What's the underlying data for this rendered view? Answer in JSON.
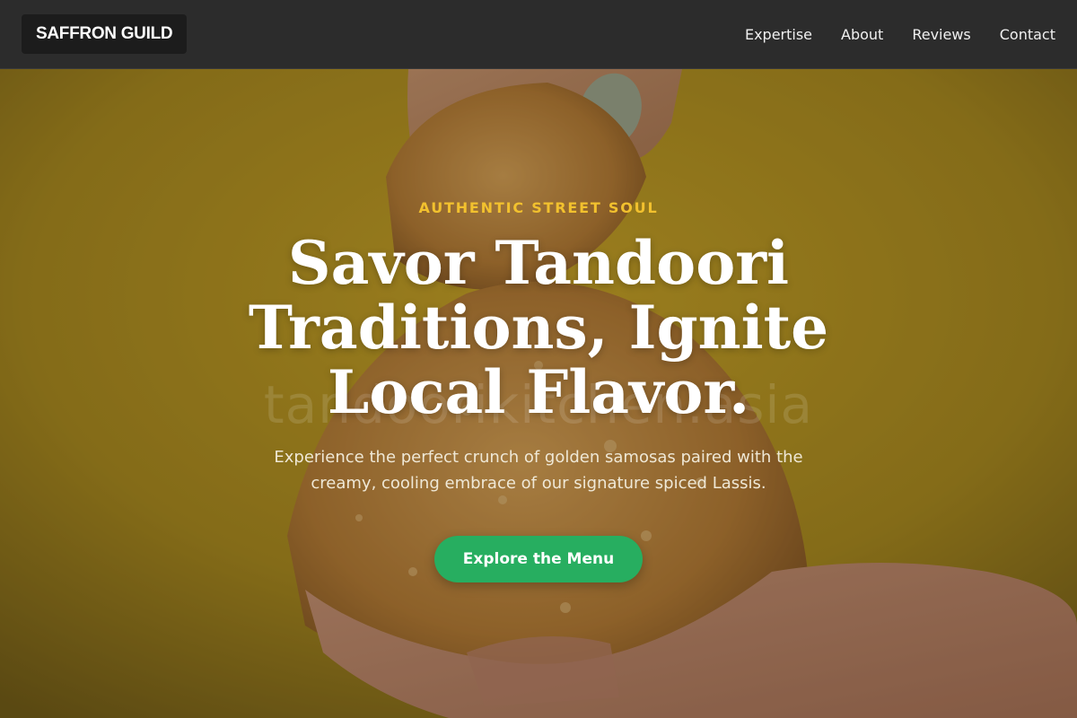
{
  "header": {
    "brand": "SAFFRON GUILD",
    "nav": [
      "Expertise",
      "About",
      "Reviews",
      "Contact"
    ]
  },
  "hero": {
    "eyebrow": "AUTHENTIC STREET SOUL",
    "headline": "Savor Tandoori Traditions, Ignite Local Flavor.",
    "subhead": "Experience the perfect crunch of golden samosas paired with the creamy, cooling embrace of our signature spiced Lassis.",
    "cta": "Explore the Menu",
    "watermark": "tandoorikitchen.asia"
  },
  "colors": {
    "header_bg": "#2c2c2c",
    "accent_gold": "#f2c12e",
    "cta_green": "#27ae60",
    "hero_backdrop": "#b8961f"
  },
  "images": {
    "hero_photo": "hand-holding-samosa-photo"
  }
}
